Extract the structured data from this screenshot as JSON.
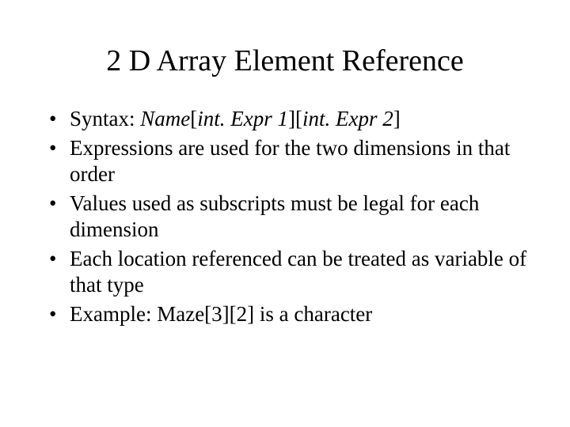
{
  "title": "2 D Array Element Reference",
  "bullets": [
    {
      "prefix": "Syntax: ",
      "italic1": "Name",
      "mid1": "[",
      "italic2": "int. Expr 1",
      "mid2": "][",
      "italic3": "int. Expr 2",
      "suffix": "]"
    },
    {
      "text": "Expressions are used for the two dimensions in that order"
    },
    {
      "text": "Values used as subscripts must be legal for each dimension"
    },
    {
      "text": "Each location referenced can be treated as variable of that type"
    },
    {
      "text": "Example:  Maze[3][2] is a character"
    }
  ]
}
